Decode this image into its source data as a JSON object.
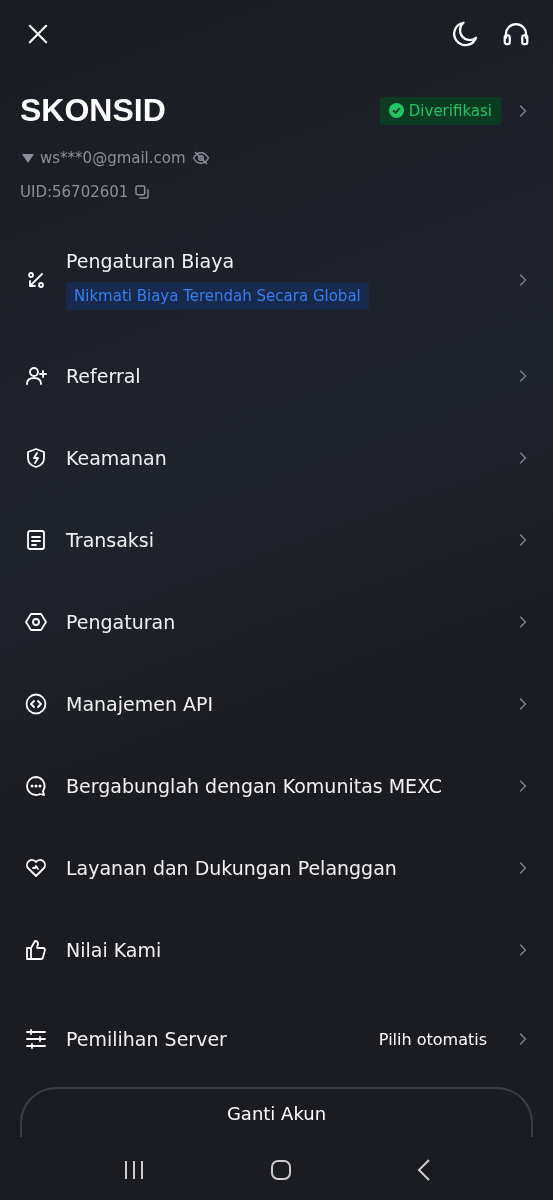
{
  "profile": {
    "name": "SKONSID",
    "badge": "Diverifikasi",
    "email": "ws***0@gmail.com",
    "uid": "UID:56702601"
  },
  "menu": [
    {
      "label": "Pengaturan Biaya",
      "tag": "Nikmati Biaya Terendah Secara Global"
    },
    {
      "label": "Referral"
    },
    {
      "label": "Keamanan"
    },
    {
      "label": "Transaksi"
    },
    {
      "label": "Pengaturan"
    },
    {
      "label": "Manajemen API"
    },
    {
      "label": "Bergabunglah dengan Komunitas MEXC"
    },
    {
      "label": "Layanan dan Dukungan Pelanggan"
    },
    {
      "label": "Nilai Kami"
    },
    {
      "label": "Pemilihan Server",
      "value": "Pilih otomatis"
    }
  ],
  "switch_button": "Ganti Akun"
}
